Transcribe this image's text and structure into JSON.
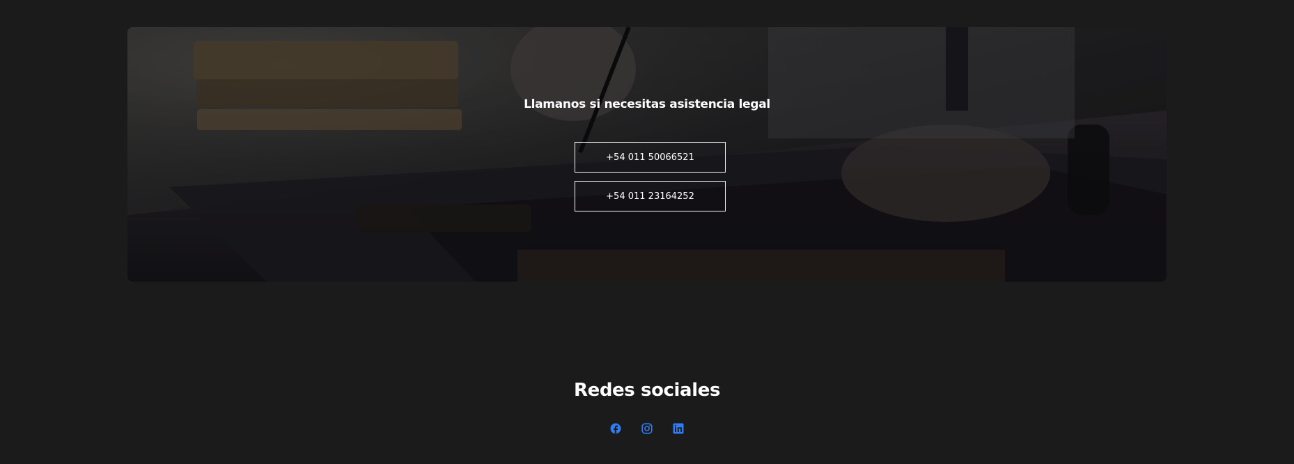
{
  "hero": {
    "title": "Llamanos si necesitas asistencia legal",
    "phones": [
      "+54 011 50066521",
      "+54 011 23164252"
    ]
  },
  "social": {
    "title": "Redes sociales",
    "icons": [
      "facebook-icon",
      "instagram-icon",
      "linkedin-icon"
    ],
    "icon_color": "#2f7cf6"
  },
  "colors": {
    "background": "#1b1b1b",
    "text": "#ffffff"
  }
}
